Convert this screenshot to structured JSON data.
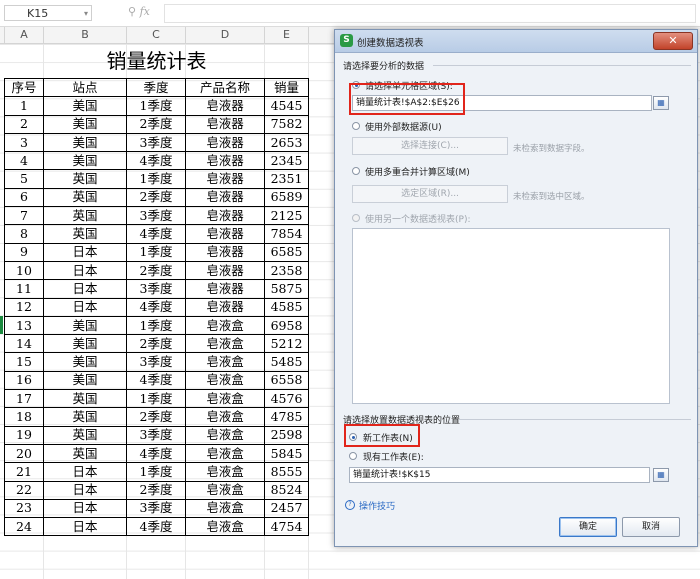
{
  "formula_bar": {
    "cell_ref": "K15",
    "fx": "fx"
  },
  "columns": [
    "A",
    "B",
    "C",
    "D",
    "E"
  ],
  "sheet": {
    "title": "销量统计表",
    "headers": [
      "序号",
      "站点",
      "季度",
      "产品名称",
      "销量"
    ],
    "rows": [
      [
        "1",
        "美国",
        "1季度",
        "皂液器",
        "4545"
      ],
      [
        "2",
        "美国",
        "2季度",
        "皂液器",
        "7582"
      ],
      [
        "3",
        "美国",
        "3季度",
        "皂液器",
        "2653"
      ],
      [
        "4",
        "美国",
        "4季度",
        "皂液器",
        "2345"
      ],
      [
        "5",
        "英国",
        "1季度",
        "皂液器",
        "2351"
      ],
      [
        "6",
        "英国",
        "2季度",
        "皂液器",
        "6589"
      ],
      [
        "7",
        "英国",
        "3季度",
        "皂液器",
        "2125"
      ],
      [
        "8",
        "英国",
        "4季度",
        "皂液器",
        "7854"
      ],
      [
        "9",
        "日本",
        "1季度",
        "皂液器",
        "6585"
      ],
      [
        "10",
        "日本",
        "2季度",
        "皂液器",
        "2358"
      ],
      [
        "11",
        "日本",
        "3季度",
        "皂液器",
        "5875"
      ],
      [
        "12",
        "日本",
        "4季度",
        "皂液器",
        "4585"
      ],
      [
        "13",
        "美国",
        "1季度",
        "皂液盒",
        "6958"
      ],
      [
        "14",
        "美国",
        "2季度",
        "皂液盒",
        "5212"
      ],
      [
        "15",
        "美国",
        "3季度",
        "皂液盒",
        "5485"
      ],
      [
        "16",
        "美国",
        "4季度",
        "皂液盒",
        "6558"
      ],
      [
        "17",
        "英国",
        "1季度",
        "皂液盒",
        "4576"
      ],
      [
        "18",
        "英国",
        "2季度",
        "皂液盒",
        "4785"
      ],
      [
        "19",
        "英国",
        "3季度",
        "皂液盒",
        "2598"
      ],
      [
        "20",
        "英国",
        "4季度",
        "皂液盒",
        "5845"
      ],
      [
        "21",
        "日本",
        "1季度",
        "皂液盒",
        "8555"
      ],
      [
        "22",
        "日本",
        "2季度",
        "皂液盒",
        "8524"
      ],
      [
        "23",
        "日本",
        "3季度",
        "皂液盒",
        "2457"
      ],
      [
        "24",
        "日本",
        "4季度",
        "皂液盒",
        "4754"
      ]
    ]
  },
  "dialog": {
    "title": "创建数据透视表",
    "app_icon": "S",
    "close_icon": "close-icon",
    "section_analyze": "请选择要分析的数据",
    "opt_range": "请选择单元格区域(S):",
    "range_value": "销量统计表!$A$2:$E$26",
    "opt_external": "使用外部数据源(U)",
    "btn_choose_conn": "选择连接(C)...",
    "hint_no_field": "未检索到数据字段。",
    "opt_multi": "使用多重合并计算区域(M)",
    "btn_choose_region": "选定区域(R)...",
    "hint_no_region": "未检索到选中区域。",
    "opt_other_pivot": "使用另一个数据透视表(P):",
    "section_place": "请选择放置数据透视表的位置",
    "opt_new_sheet": "新工作表(N)",
    "opt_existing": "现有工作表(E):",
    "existing_value": "销量统计表!$K$15",
    "tips": "操作技巧",
    "ok": "确定",
    "cancel": "取消"
  }
}
